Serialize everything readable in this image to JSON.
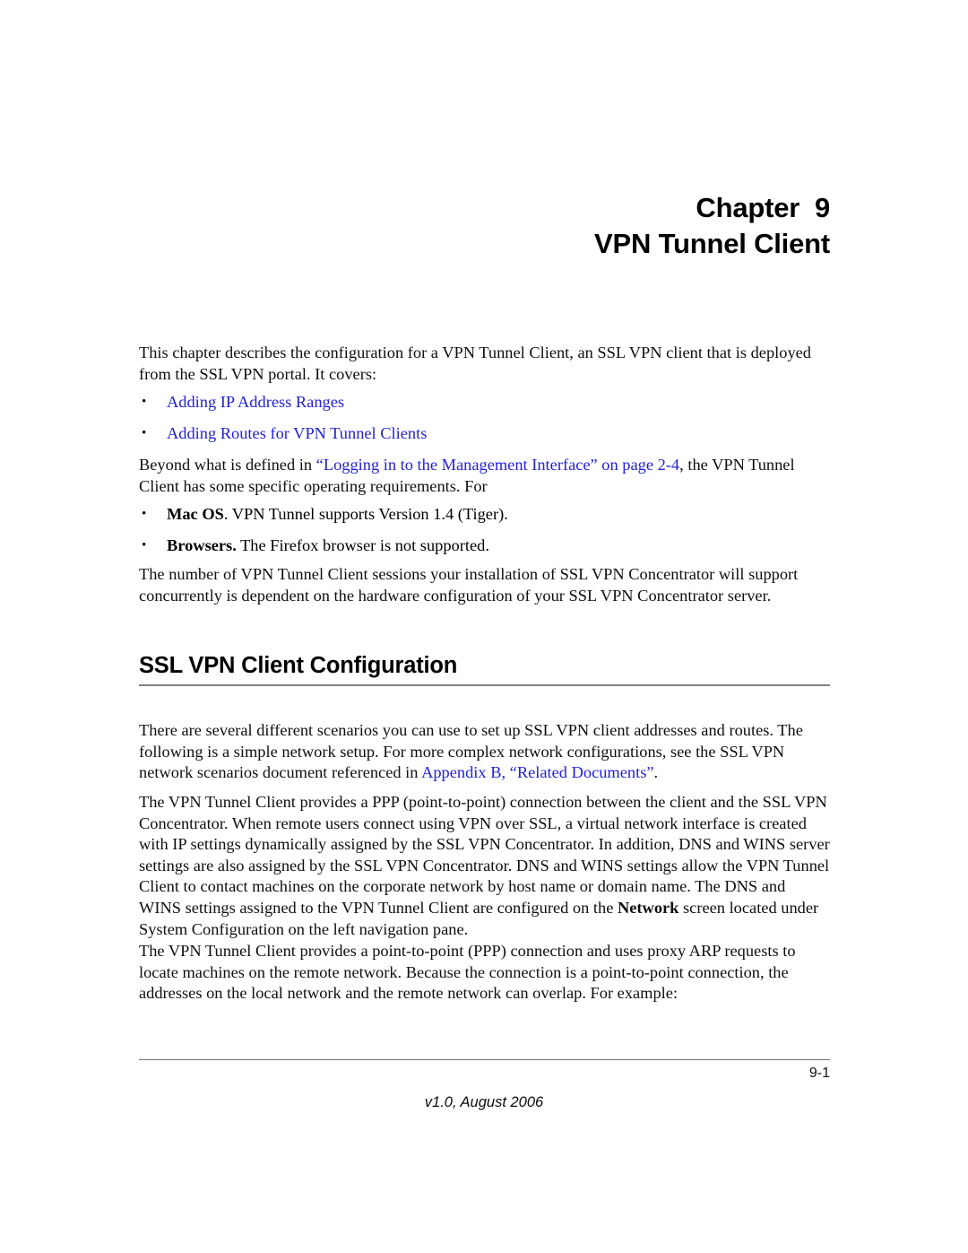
{
  "document": {
    "chapter_label": "Chapter  9",
    "chapter_title": "VPN Tunnel Client"
  },
  "intro": {
    "paragraph": "This chapter describes the configuration for a VPN Tunnel Client, an SSL VPN client that is deployed from the SSL VPN portal. It covers:",
    "topic_links": [
      "Adding IP Address Ranges",
      "Adding Routes for VPN Tunnel Clients"
    ]
  },
  "requirements": {
    "lead_in_before_link": "Beyond what is defined in ",
    "lead_in_link": "“Logging in to the Management Interface” on page 2-4",
    "lead_in_after_link": ", the VPN Tunnel Client has some specific operating requirements. For",
    "items": [
      {
        "bold": "Mac OS",
        "rest": ". VPN Tunnel supports Version 1.4 (Tiger)."
      },
      {
        "bold": "Browsers.",
        "rest": " The Firefox browser is not supported."
      }
    ],
    "sessions_paragraph": "The number of VPN Tunnel Client sessions your installation of SSL VPN Concentrator will support concurrently is dependent on the hardware configuration of your SSL VPN Concentrator server."
  },
  "section": {
    "heading": "SSL VPN Client Configuration",
    "scenarios_before_link": "There are several different scenarios you can use to set up SSL VPN client addresses and routes. The following is a simple network setup. For more complex network configurations, see the SSL VPN network scenarios document referenced in ",
    "scenarios_link": "Appendix B, “Related Documents”",
    "scenarios_after_link": ".",
    "ppp_paragraph_before_bold": "The VPN Tunnel Client provides a PPP (point-to-point) connection between the client and the SSL VPN Concentrator. When remote users connect using VPN over SSL, a virtual network interface is created with IP settings dynamically assigned by the SSL VPN Concentrator. In addition, DNS and WINS server settings are also assigned by the SSL VPN Concentrator. DNS and WINS settings allow the VPN Tunnel Client to contact machines on the corporate network by host name or domain name. The DNS and WINS settings assigned to the VPN Tunnel Client are configured on the ",
    "ppp_paragraph_bold": "Network",
    "ppp_paragraph_after_bold": " screen located under System Configuration on the left navigation pane.",
    "proxy_arp_paragraph": "The VPN Tunnel Client provides a point-to-point (PPP) connection and uses proxy ARP requests to locate machines on the remote network. Because the connection is a point-to-point connection, the addresses on the local network and the remote network can overlap. For example:"
  },
  "footer": {
    "page_number": "9-1",
    "version": "v1.0, August 2006"
  },
  "icons": {
    "bullet_glyph": "•"
  },
  "colors": {
    "link": "#2121d6",
    "text": "#100f0f",
    "rule": "#848484"
  }
}
